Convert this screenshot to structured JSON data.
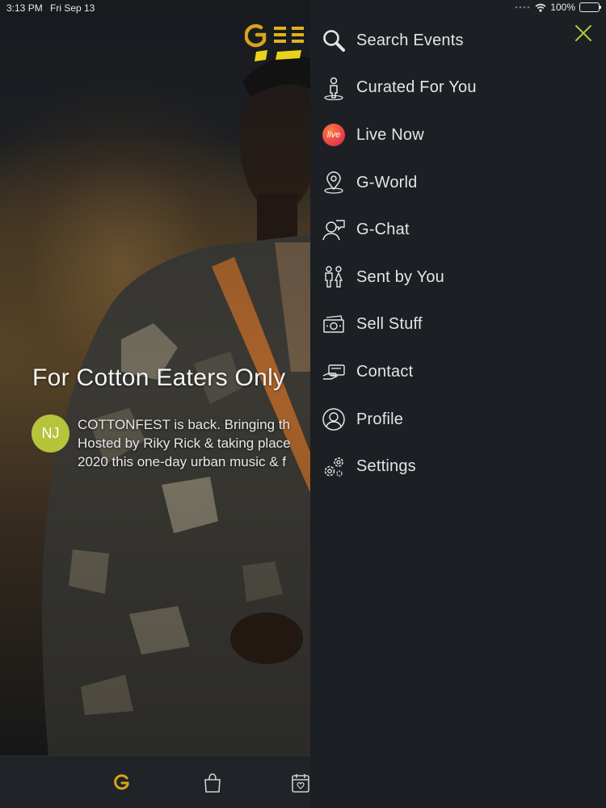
{
  "status_bar": {
    "time": "3:13 PM",
    "date": "Fri Sep 13",
    "battery": "100%"
  },
  "event": {
    "title": "For Cotton Eaters Only",
    "author_initials": "NJ",
    "description_lines": [
      "COTTONFEST is back. Bringing th",
      "Hosted by Riky Rick & taking place",
      "2020 this one-day urban music & f"
    ]
  },
  "menu": {
    "items": [
      {
        "label": "Search Events",
        "icon": "search-icon"
      },
      {
        "label": "Curated For You",
        "icon": "curated-person-icon"
      },
      {
        "label": "Live Now",
        "icon": "live-icon",
        "badge": "live"
      },
      {
        "label": "G-World",
        "icon": "map-pin-icon"
      },
      {
        "label": "G-Chat",
        "icon": "chat-person-icon"
      },
      {
        "label": "Sent by You",
        "icon": "couple-icon"
      },
      {
        "label": "Sell Stuff",
        "icon": "money-icon"
      },
      {
        "label": "Contact",
        "icon": "hand-card-icon"
      },
      {
        "label": "Profile",
        "icon": "profile-circle-icon"
      },
      {
        "label": "Settings",
        "icon": "gears-icon"
      }
    ]
  },
  "colors": {
    "accent": "#d9a21b",
    "close_icon": "#b7c43c",
    "avatar": "#b5c43a",
    "menu_bg": "#1c1f24"
  }
}
